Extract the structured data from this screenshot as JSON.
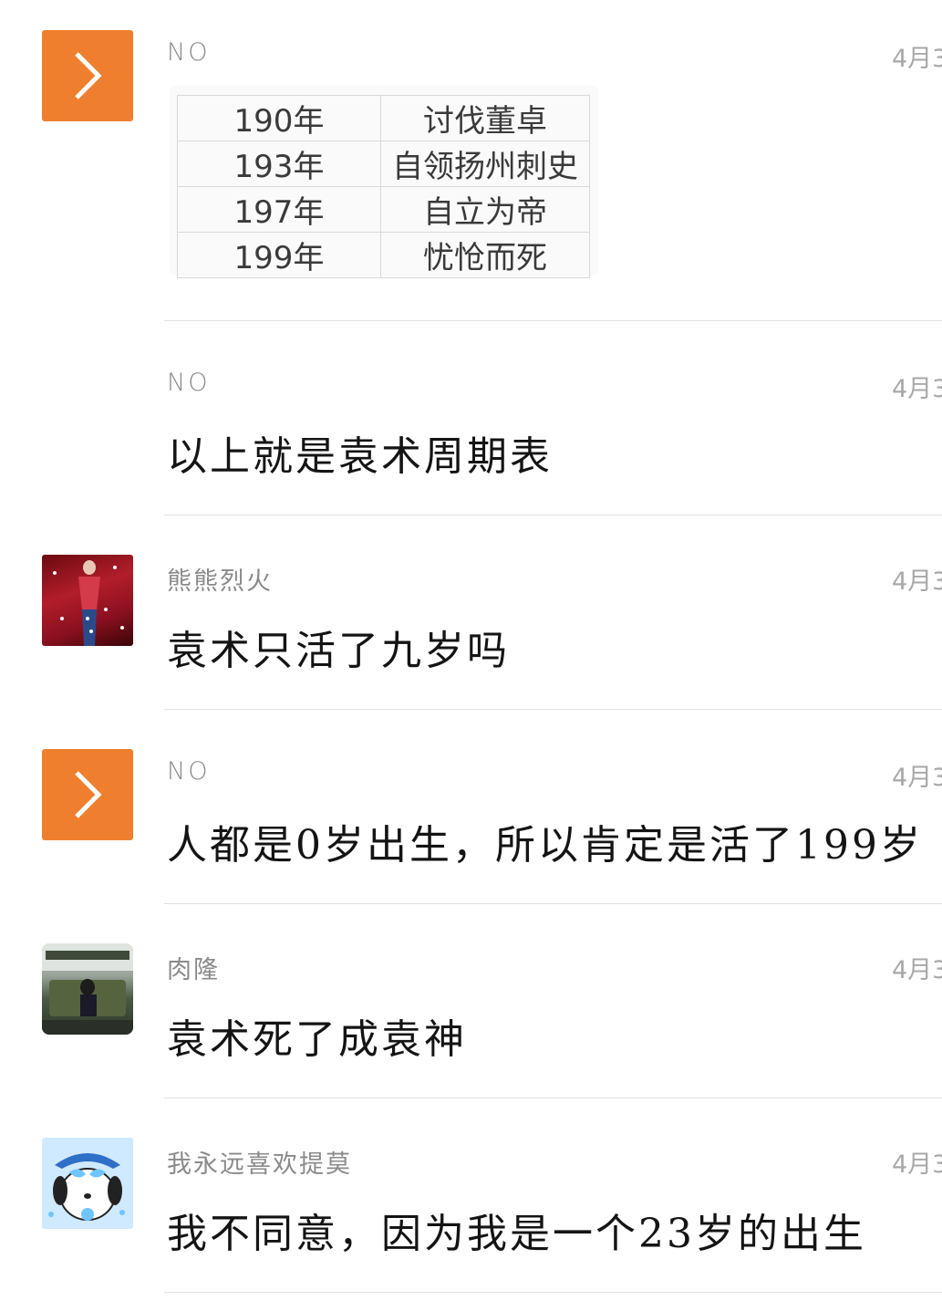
{
  "comments": [
    {
      "username": "NO",
      "time": "4月3",
      "image_table": {
        "rows": [
          {
            "year": "190年",
            "event": "讨伐董卓"
          },
          {
            "year": "193年",
            "event": "自领扬州刺史"
          },
          {
            "year": "197年",
            "event": "自立为帝"
          },
          {
            "year": "199年",
            "event": "忧怆而死"
          }
        ]
      }
    },
    {
      "username": "NO",
      "time": "4月3",
      "content": "以上就是袁术周期表"
    },
    {
      "username": "熊熊烈火",
      "time": "4月3",
      "content": "袁术只活了九岁吗"
    },
    {
      "username": "NO",
      "time": "4月3",
      "content": "人都是0岁出生，所以肯定是活了199岁"
    },
    {
      "username": "肉隆",
      "time": "4月3",
      "content": "袁术死了成袁神"
    },
    {
      "username": "我永远喜欢提莫",
      "time": "4月3",
      "content": "我不同意，因为我是一个23岁的出生"
    }
  ],
  "colors": {
    "accent_avatar": "#ef7f2e",
    "username": "#8a8a8a",
    "time": "#a8a8a8"
  },
  "icons": {
    "orange_avatar": "chevron-right-icon"
  }
}
